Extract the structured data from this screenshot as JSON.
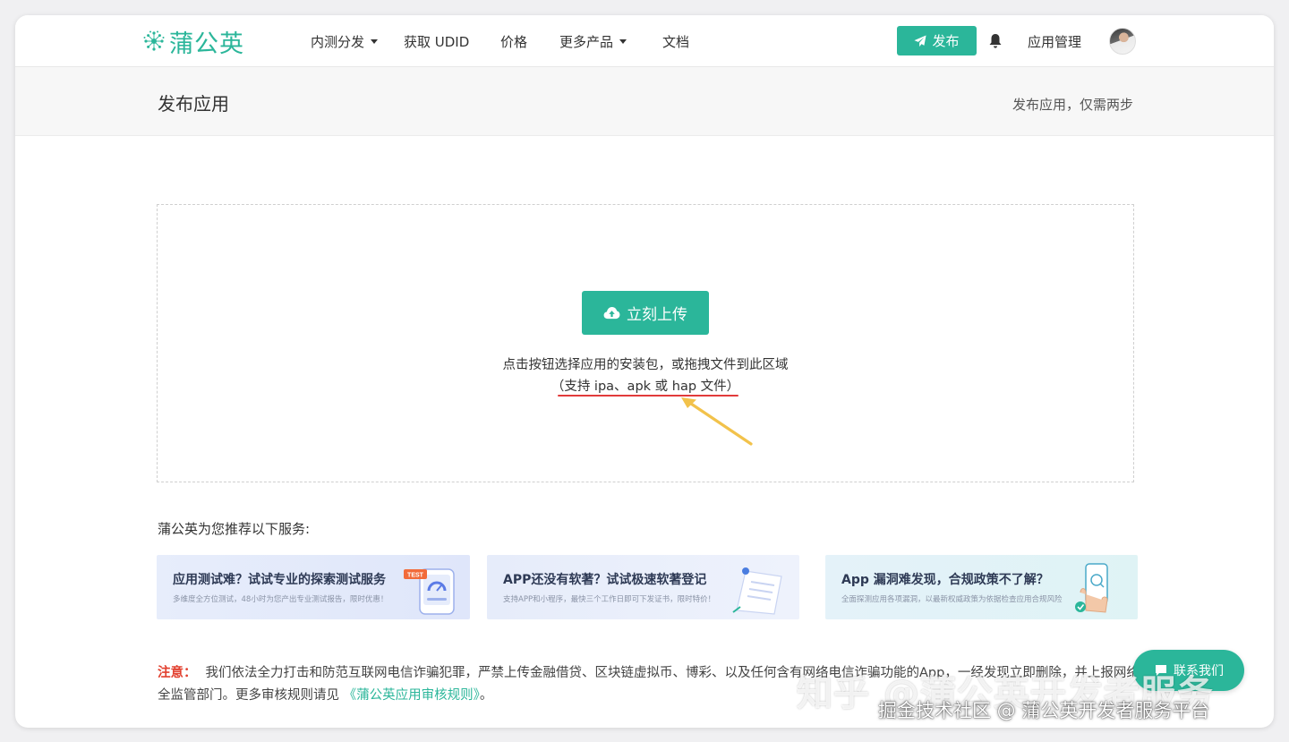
{
  "brand": {
    "name": "蒲公英",
    "color": "#2bb69a"
  },
  "nav": {
    "items": [
      {
        "label": "内测分发",
        "has_dropdown": true
      },
      {
        "label": "获取 UDID",
        "has_dropdown": false
      },
      {
        "label": "价格",
        "has_dropdown": false
      },
      {
        "label": "更多产品",
        "has_dropdown": true
      },
      {
        "label": "文档",
        "has_dropdown": false
      }
    ],
    "publish_label": "发布",
    "notification_icon": "bell-icon",
    "app_management_label": "应用管理",
    "avatar_icon": "user-avatar"
  },
  "subheader": {
    "title": "发布应用",
    "right_text": "发布应用，仅需两步"
  },
  "upload": {
    "button_label": "立刻上传",
    "button_icon": "cloud-upload-icon",
    "hint": "点击按钮选择应用的安装包，或拖拽文件到此区域",
    "formats": "（支持 ipa、apk 或 hap 文件）",
    "annotation_color": "#e23b3b",
    "arrow_color": "#f2c24b"
  },
  "services": {
    "label": "蒲公英为您推荐以下服务:",
    "cards": [
      {
        "title": "应用测试难？试试专业的探索测试服务",
        "desc": "多维度全方位测试，48小时为您产出专业测试报告，限时优惠！",
        "icon": "test-report-illustration",
        "badge": "TEST"
      },
      {
        "title": "APP还没有软著？试试极速软著登记",
        "desc": "支持APP和小程序，最快三个工作日即可下发证书，限时特价！",
        "icon": "certificate-illustration"
      },
      {
        "title": "App 漏洞难发现，合规政策不了解？",
        "desc": "全面探测应用各项漏洞，以最新权威政策为依据检查应用合规风险",
        "icon": "phone-scan-illustration"
      }
    ]
  },
  "notice": {
    "label": "注意：",
    "text": "我们依法全力打击和防范互联网电信诈骗犯罪，严禁上传金融借贷、区块链虚拟币、博彩、以及任何含有网络电信诈骗功能的App，一经发现立即删除，并上报网络安全监管部门。更多审核规则请见",
    "link_text": "《蒲公英应用审核规则》",
    "end": "。"
  },
  "contact": {
    "label": "联系我们",
    "icon": "chat-icon"
  },
  "watermarks": {
    "zhihu": "知乎 @蒲公英开发者服务",
    "juejin": "掘金技术社区 @ 蒲公英开发者服务平台"
  }
}
